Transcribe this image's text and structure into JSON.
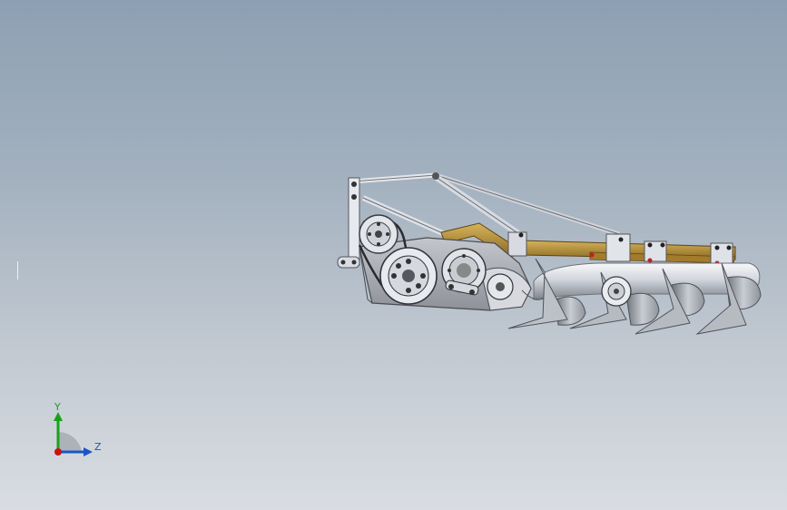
{
  "view": {
    "background_top": "#8da0b3",
    "background_bottom": "#d9dde2"
  },
  "model": {
    "frame_color": "#b08b3a",
    "housing_color": "#a9a9b3",
    "metal_color": "#dfe3ea"
  },
  "triad": {
    "y_label": "Y",
    "z_label": "Z",
    "y_color": "#1aa11a",
    "z_color": "#1a55c8",
    "x_color": "#cc1111"
  }
}
